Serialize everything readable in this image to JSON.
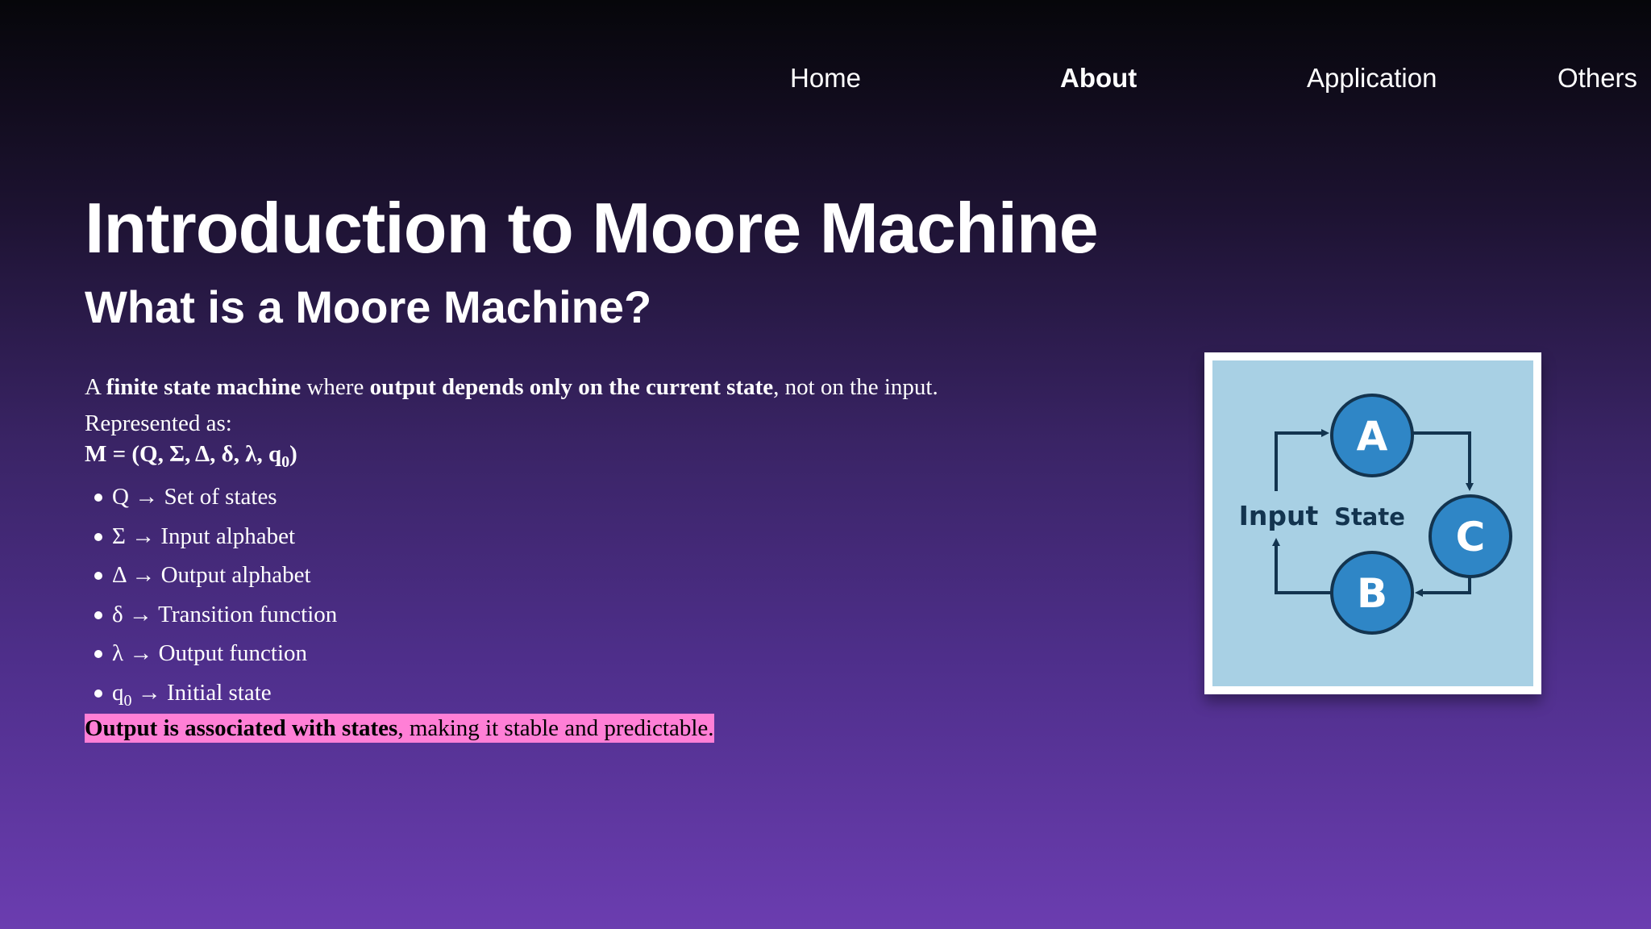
{
  "nav": {
    "items": [
      {
        "label": "Home",
        "active": false
      },
      {
        "label": "About",
        "active": true
      },
      {
        "label": "Application",
        "active": false
      },
      {
        "label": "Others",
        "active": false
      }
    ]
  },
  "hero": {
    "title": "Introduction to Moore Machine",
    "subtitle": "What is a Moore Machine?"
  },
  "content": {
    "intro": {
      "p1": "A ",
      "b1": "finite state machine",
      "p2": " where ",
      "b2": "output depends only on the current state",
      "p3": ", not on the input."
    },
    "represented_as": "Represented as:",
    "tuple": {
      "main": "M = (Q, Σ, Δ, δ, λ, q",
      "sub": "0",
      "end": ")"
    },
    "bullets": [
      {
        "symbol": "Q",
        "arrow": " → ",
        "text": "Set of states"
      },
      {
        "symbol": "Σ",
        "arrow": " → ",
        "text": "Input alphabet"
      },
      {
        "symbol": "Δ",
        "arrow": " → ",
        "text": "Output alphabet"
      },
      {
        "symbol": "δ",
        "arrow": " → ",
        "text": "Transition function"
      },
      {
        "symbol": "λ",
        "arrow": " → ",
        "text": "Output function"
      }
    ],
    "last_bullet": {
      "symbol": "q",
      "sub": "0",
      "arrow": " → ",
      "text": "Initial state"
    },
    "highlight": {
      "bold": "Output is associated with states",
      "rest": ", making it stable and predictable."
    },
    "highlight_color": "#ff7fd6"
  },
  "figure": {
    "labels": {
      "input": "Input",
      "state": "State"
    },
    "states": [
      "A",
      "B",
      "C"
    ],
    "node_color": "#2f86c6",
    "background_color": "#a8d0e4"
  }
}
